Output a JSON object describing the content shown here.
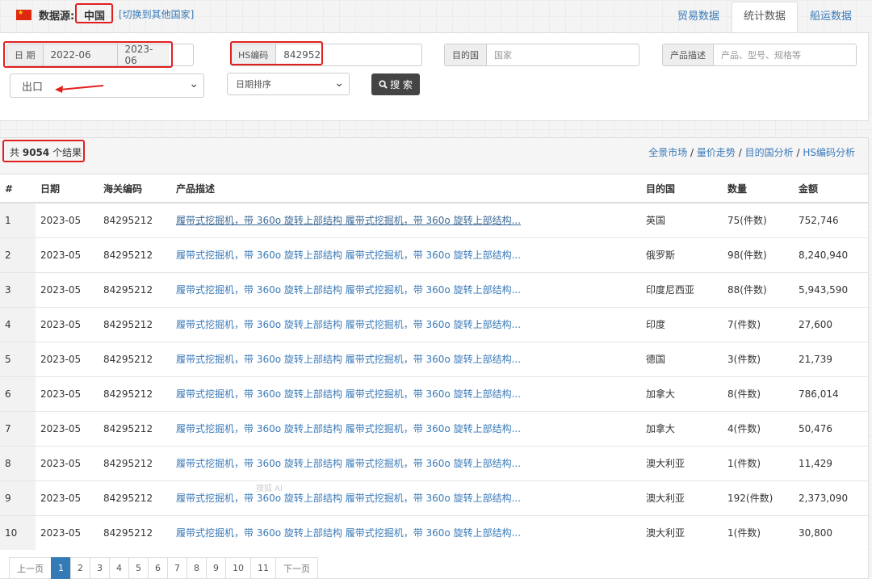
{
  "header": {
    "source_label": "数据源:",
    "country": "中国",
    "switch_link": "[切换到其他国家]",
    "tabs": [
      "贸易数据",
      "统计数据",
      "船运数据"
    ],
    "active_tab": 1
  },
  "filters": {
    "date_label": "日 期",
    "date_from": "2022-06",
    "date_to": "2023-06",
    "hs_label": "HS编码",
    "hs_value": "842952",
    "dest_label": "目的国",
    "dest_placeholder": "国家",
    "desc_label": "产品描述",
    "desc_placeholder": "产品、型号、规格等",
    "trade_type": "出口",
    "sort": "日期排序",
    "search_label": "搜 索"
  },
  "results": {
    "count_prefix": "共",
    "count": "9054",
    "count_suffix": "个结果",
    "analysis_links": [
      "全景市场",
      "量价走势",
      "目的国分析",
      "HS编码分析"
    ],
    "separator": "/",
    "columns": [
      "#",
      "日期",
      "海关编码",
      "产品描述",
      "目的国",
      "数量",
      "金额"
    ],
    "rows": [
      {
        "n": "1",
        "date": "2023-05",
        "hs": "84295212",
        "desc": "履带式挖掘机，带 360o 旋转上部结构 履带式挖掘机，带 360o 旋转上部结构...",
        "dest": "英国",
        "qty": "75(件数)",
        "amt": "752,746"
      },
      {
        "n": "2",
        "date": "2023-05",
        "hs": "84295212",
        "desc": "履带式挖掘机，带 360o 旋转上部结构 履带式挖掘机，带 360o 旋转上部结构...",
        "dest": "俄罗斯",
        "qty": "98(件数)",
        "amt": "8,240,940"
      },
      {
        "n": "3",
        "date": "2023-05",
        "hs": "84295212",
        "desc": "履带式挖掘机，带 360o 旋转上部结构 履带式挖掘机，带 360o 旋转上部结构...",
        "dest": "印度尼西亚",
        "qty": "88(件数)",
        "amt": "5,943,590"
      },
      {
        "n": "4",
        "date": "2023-05",
        "hs": "84295212",
        "desc": "履带式挖掘机，带 360o 旋转上部结构 履带式挖掘机，带 360o 旋转上部结构...",
        "dest": "印度",
        "qty": "7(件数)",
        "amt": "27,600"
      },
      {
        "n": "5",
        "date": "2023-05",
        "hs": "84295212",
        "desc": "履带式挖掘机，带 360o 旋转上部结构 履带式挖掘机，带 360o 旋转上部结构...",
        "dest": "德国",
        "qty": "3(件数)",
        "amt": "21,739"
      },
      {
        "n": "6",
        "date": "2023-05",
        "hs": "84295212",
        "desc": "履带式挖掘机，带 360o 旋转上部结构 履带式挖掘机，带 360o 旋转上部结构...",
        "dest": "加拿大",
        "qty": "8(件数)",
        "amt": "786,014"
      },
      {
        "n": "7",
        "date": "2023-05",
        "hs": "84295212",
        "desc": "履带式挖掘机，带 360o 旋转上部结构 履带式挖掘机，带 360o 旋转上部结构...",
        "dest": "加拿大",
        "qty": "4(件数)",
        "amt": "50,476"
      },
      {
        "n": "8",
        "date": "2023-05",
        "hs": "84295212",
        "desc": "履带式挖掘机，带 360o 旋转上部结构 履带式挖掘机，带 360o 旋转上部结构...",
        "dest": "澳大利亚",
        "qty": "1(件数)",
        "amt": "11,429"
      },
      {
        "n": "9",
        "date": "2023-05",
        "hs": "84295212",
        "desc": "履带式挖掘机，带 360o 旋转上部结构 履带式挖掘机，带 360o 旋转上部结构...",
        "dest": "澳大利亚",
        "qty": "192(件数)",
        "amt": "2,373,090"
      },
      {
        "n": "10",
        "date": "2023-05",
        "hs": "84295212",
        "desc": "履带式挖掘机，带 360o 旋转上部结构 履带式挖掘机，带 360o 旋转上部结构...",
        "dest": "澳大利亚",
        "qty": "1(件数)",
        "amt": "30,800"
      }
    ]
  },
  "pagination": {
    "prev": "上一页",
    "pages": [
      "1",
      "2",
      "3",
      "4",
      "5",
      "6",
      "7",
      "8",
      "9",
      "10",
      "11"
    ],
    "active_page": "1",
    "next": "下一页"
  },
  "watermark": "搜狐 AI",
  "colors": {
    "link": "#3a7ab8",
    "highlight": "#e0201f",
    "active_page": "#337ab7",
    "search_button": "#444444"
  },
  "icons": {
    "flag": "china-flag-icon",
    "search": "search-icon",
    "arrow": "red-arrow-icon",
    "chevron": "chevron-down-icon"
  }
}
